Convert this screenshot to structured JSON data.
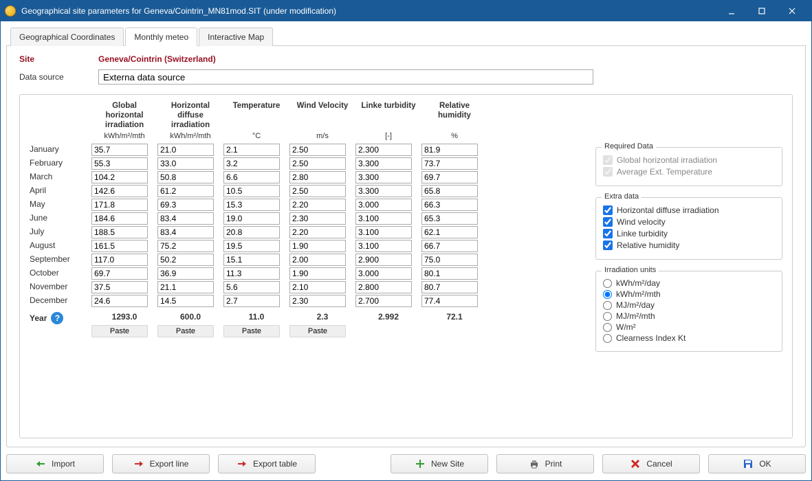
{
  "window": {
    "title": "Geographical site parameters for Geneva/Cointrin_MN81mod.SIT (under modification)"
  },
  "tabs": {
    "geo": "Geographical Coordinates",
    "monthly": "Monthly meteo",
    "map": "Interactive Map"
  },
  "site": {
    "label": "Site",
    "name": "Geneva/Cointrin   (Switzerland)"
  },
  "datasource": {
    "label": "Data source",
    "value": "Externa data source"
  },
  "headers": {
    "ghi": "Global horizontal irradiation",
    "dhi": "Horizontal diffuse irradiation",
    "temp": "Temperature",
    "wind": "Wind Velocity",
    "linke": "Linke turbidity",
    "rh": "Relative humidity"
  },
  "units": {
    "ghi": "kWh/m²/mth",
    "dhi": "kWh/m²/mth",
    "temp": "°C",
    "wind": "m/s",
    "linke": "[-]",
    "rh": "%"
  },
  "months": [
    "January",
    "February",
    "March",
    "April",
    "May",
    "June",
    "July",
    "August",
    "September",
    "October",
    "November",
    "December"
  ],
  "data": {
    "ghi": [
      "35.7",
      "55.3",
      "104.2",
      "142.6",
      "171.8",
      "184.6",
      "188.5",
      "161.5",
      "117.0",
      "69.7",
      "37.5",
      "24.6"
    ],
    "dhi": [
      "21.0",
      "33.0",
      "50.8",
      "61.2",
      "69.3",
      "83.4",
      "83.4",
      "75.2",
      "50.2",
      "36.9",
      "21.1",
      "14.5"
    ],
    "temp": [
      "2.1",
      "3.2",
      "6.6",
      "10.5",
      "15.3",
      "19.0",
      "20.8",
      "19.5",
      "15.1",
      "11.3",
      "5.6",
      "2.7"
    ],
    "wind": [
      "2.50",
      "2.50",
      "2.80",
      "2.50",
      "2.20",
      "2.30",
      "2.20",
      "1.90",
      "2.00",
      "1.90",
      "2.10",
      "2.30"
    ],
    "linke": [
      "2.300",
      "3.300",
      "3.300",
      "3.300",
      "3.000",
      "3.100",
      "3.100",
      "3.100",
      "2.900",
      "3.000",
      "2.800",
      "2.700"
    ],
    "rh": [
      "81.9",
      "73.7",
      "69.7",
      "65.8",
      "66.3",
      "65.3",
      "62.1",
      "66.7",
      "75.0",
      "80.1",
      "80.7",
      "77.4"
    ]
  },
  "year": {
    "label": "Year",
    "ghi": "1293.0",
    "dhi": "600.0",
    "temp": "11.0",
    "wind": "2.3",
    "linke": "2.992",
    "rh": "72.1"
  },
  "paste": "Paste",
  "required": {
    "legend": "Required Data",
    "ghi": "Global horizontal irradiation",
    "temp": "Average Ext. Temperature"
  },
  "extra": {
    "legend": "Extra data",
    "dhi": "Horizontal diffuse irradiation",
    "wind": "Wind velocity",
    "linke": "Linke turbidity",
    "rh": "Relative humidity"
  },
  "irrunits": {
    "legend": "Irradiation units",
    "opts": [
      "kWh/m²/day",
      "kWh/m²/mth",
      "MJ/m²/day",
      "MJ/m²/mth",
      "W/m²",
      "Clearness Index Kt"
    ],
    "selected": 1
  },
  "buttons": {
    "import": "Import",
    "exportline": "Export line",
    "exporttable": "Export table",
    "newsite": "New Site",
    "print": "Print",
    "cancel": "Cancel",
    "ok": "OK"
  }
}
